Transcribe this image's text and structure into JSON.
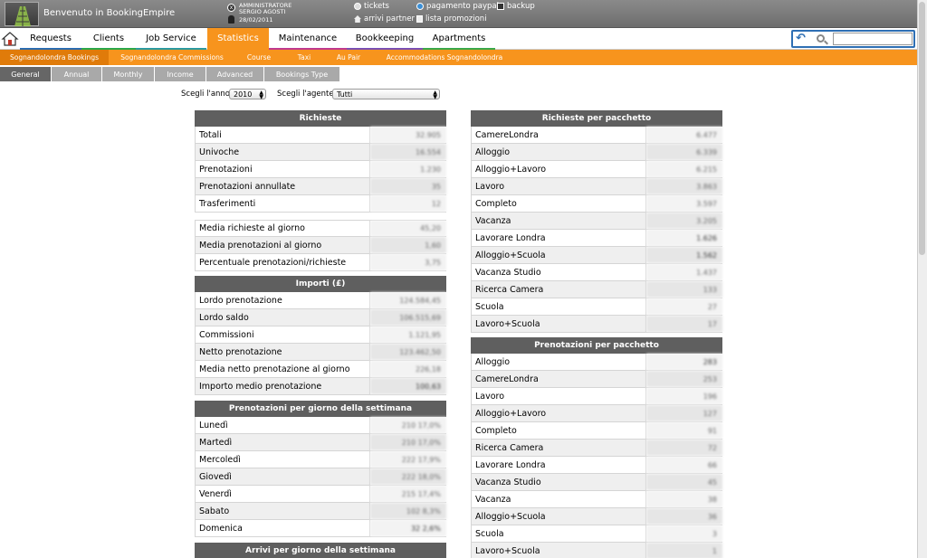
{
  "header": {
    "welcome": "Benvenuto in BookingEmpire",
    "user_role": "AMMINISTRATORE",
    "user_name": "SERGIO AGOSTI",
    "date": "28/02/2011",
    "links": {
      "tickets": "tickets",
      "pagamento_paypal": "pagamento paypal",
      "backup": "backup",
      "arrivi_partner": "arrivi partner",
      "lista_promozioni": "lista promozioni"
    }
  },
  "menu": {
    "tabs": [
      {
        "label": "Requests",
        "color": "#2b6cb0"
      },
      {
        "label": "Clients",
        "color": "#2ba84a"
      },
      {
        "label": "Job Service",
        "color": "#2b9aa0"
      },
      {
        "label": "Statistics",
        "color": "#f7941d",
        "active": true
      },
      {
        "label": "Maintenance",
        "color": "#c0398e"
      },
      {
        "label": "Bookkeeping",
        "color": "#7a4fb3"
      },
      {
        "label": "Apartments",
        "color": "#3aa84a"
      }
    ]
  },
  "submenu": {
    "tabs": [
      {
        "label": "Sognandolondra Bookings",
        "active": true
      },
      {
        "label": "Sognandolondra Commissions"
      },
      {
        "label": "Course"
      },
      {
        "label": "Taxi"
      },
      {
        "label": "Au Pair"
      },
      {
        "label": "Accommodations Sognandolondra"
      }
    ]
  },
  "subtabs": {
    "tabs": [
      {
        "label": "General",
        "active": true
      },
      {
        "label": "Annual"
      },
      {
        "label": "Monthly"
      },
      {
        "label": "Income"
      },
      {
        "label": "Advanced"
      },
      {
        "label": "Bookings Type"
      }
    ]
  },
  "filters": {
    "year_label": "Scegli l'anno",
    "year_value": "2010",
    "agent_label": "Scegli l'agente",
    "agent_value": "Tutti"
  },
  "left": {
    "richieste": {
      "title": "Richieste",
      "rows": [
        {
          "label": "Totali",
          "value": "32.905"
        },
        {
          "label": "Univoche",
          "value": "16.554"
        },
        {
          "label": "Prenotazioni",
          "value": "1.230"
        },
        {
          "label": "Prenotazioni annullate",
          "value": "35"
        },
        {
          "label": "Trasferimenti",
          "value": "12"
        }
      ],
      "rows2": [
        {
          "label": "Media richieste al giorno",
          "value": "45,20"
        },
        {
          "label": "Media prenotazioni al giorno",
          "value": "1,60"
        },
        {
          "label": "Percentuale prenotazioni/richieste",
          "value": "3,75"
        }
      ]
    },
    "importi": {
      "title": "Importi (£)",
      "rows": [
        {
          "label": "Lordo prenotazione",
          "value": "124.584,45"
        },
        {
          "label": "Lordo saldo",
          "value": "106.515,69"
        },
        {
          "label": "Commissioni",
          "value": "1.121,95"
        },
        {
          "label": "Netto prenotazione",
          "value": "123.462,50"
        },
        {
          "label": "Media netto prenotazione al giorno",
          "value": "226,18"
        },
        {
          "label": "Importo medio prenotazione",
          "value": "100,63"
        }
      ]
    },
    "giorno": {
      "title": "Prenotazioni per giorno della settimana",
      "rows": [
        {
          "label": "Lunedì",
          "value": "210  17,0%"
        },
        {
          "label": "Martedì",
          "value": "210  17,0%"
        },
        {
          "label": "Mercoledì",
          "value": "222  17,9%"
        },
        {
          "label": "Giovedì",
          "value": "222  18,0%"
        },
        {
          "label": "Venerdì",
          "value": "215  17,4%"
        },
        {
          "label": "Sabato",
          "value": "102  8,3%"
        },
        {
          "label": "Domenica",
          "value": "32  2,6%"
        }
      ]
    },
    "arrivi": {
      "title": "Arrivi per giorno della settimana"
    }
  },
  "right": {
    "richieste_pacchetto": {
      "title": "Richieste per pacchetto",
      "rows": [
        {
          "label": "CamereLondra",
          "value": "6.477"
        },
        {
          "label": "Alloggio",
          "value": "6.339"
        },
        {
          "label": "Alloggio+Lavoro",
          "value": "6.215"
        },
        {
          "label": "Lavoro",
          "value": "3.863"
        },
        {
          "label": "Completo",
          "value": "3.597"
        },
        {
          "label": "Vacanza",
          "value": "3.205"
        },
        {
          "label": "Lavorare Londra",
          "value": "1.626"
        },
        {
          "label": "Alloggio+Scuola",
          "value": "1.562"
        },
        {
          "label": "Vacanza Studio",
          "value": "1.437"
        },
        {
          "label": "Ricerca Camera",
          "value": "133"
        },
        {
          "label": "Scuola",
          "value": "27"
        },
        {
          "label": "Lavoro+Scuola",
          "value": "17"
        }
      ]
    },
    "prenotazioni_pacchetto": {
      "title": "Prenotazioni per pacchetto",
      "rows": [
        {
          "label": "Alloggio",
          "value": "283"
        },
        {
          "label": "CamereLondra",
          "value": "253"
        },
        {
          "label": "Lavoro",
          "value": "196"
        },
        {
          "label": "Alloggio+Lavoro",
          "value": "127"
        },
        {
          "label": "Completo",
          "value": "91"
        },
        {
          "label": "Ricerca Camera",
          "value": "72"
        },
        {
          "label": "Lavorare Londra",
          "value": "66"
        },
        {
          "label": "Vacanza Studio",
          "value": "45"
        },
        {
          "label": "Vacanza",
          "value": "38"
        },
        {
          "label": "Alloggio+Scuola",
          "value": "36"
        },
        {
          "label": "Scuola",
          "value": "3"
        },
        {
          "label": "Lavoro+Scuola",
          "value": "1"
        }
      ]
    }
  }
}
